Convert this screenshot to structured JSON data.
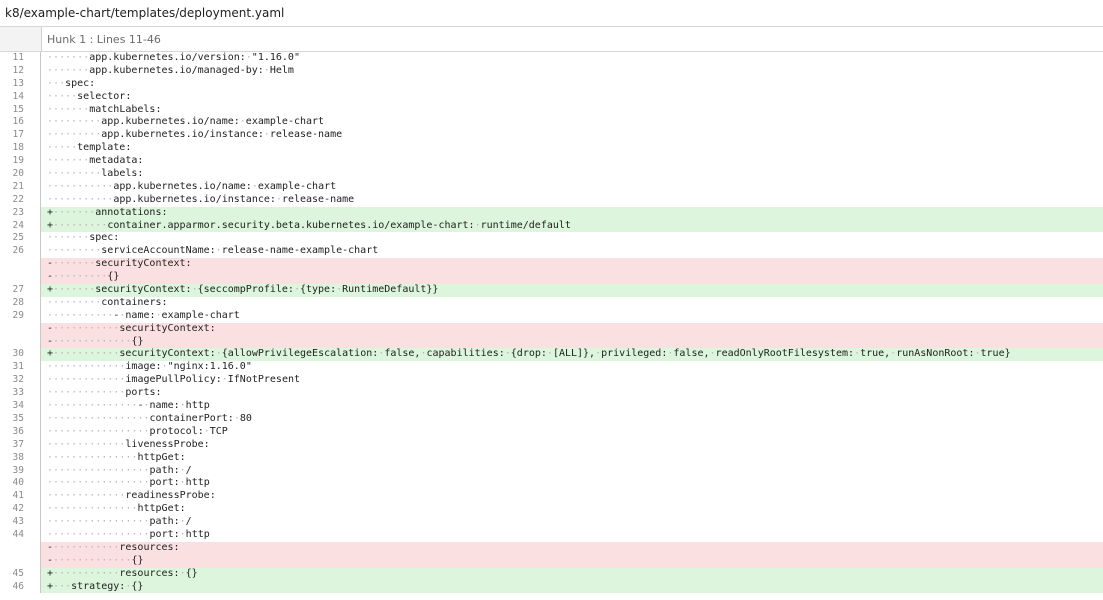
{
  "file": {
    "path": "k8/example-chart/templates/deployment.yaml"
  },
  "hunk": {
    "label": "Hunk 1 : Lines 11-46"
  },
  "lines": [
    {
      "num": "11",
      "type": "ctx",
      "sign": "",
      "text": "      app.kubernetes.io/version: \"1.16.0\""
    },
    {
      "num": "12",
      "type": "ctx",
      "sign": "",
      "text": "      app.kubernetes.io/managed-by: Helm"
    },
    {
      "num": "13",
      "type": "ctx",
      "sign": "",
      "text": "  spec:"
    },
    {
      "num": "14",
      "type": "ctx",
      "sign": "",
      "text": "    selector:"
    },
    {
      "num": "15",
      "type": "ctx",
      "sign": "",
      "text": "      matchLabels:"
    },
    {
      "num": "16",
      "type": "ctx",
      "sign": "",
      "text": "        app.kubernetes.io/name: example-chart"
    },
    {
      "num": "17",
      "type": "ctx",
      "sign": "",
      "text": "        app.kubernetes.io/instance: release-name"
    },
    {
      "num": "18",
      "type": "ctx",
      "sign": "",
      "text": "    template:"
    },
    {
      "num": "19",
      "type": "ctx",
      "sign": "",
      "text": "      metadata:"
    },
    {
      "num": "20",
      "type": "ctx",
      "sign": "",
      "text": "        labels:"
    },
    {
      "num": "21",
      "type": "ctx",
      "sign": "",
      "text": "          app.kubernetes.io/name: example-chart"
    },
    {
      "num": "22",
      "type": "ctx",
      "sign": "",
      "text": "          app.kubernetes.io/instance: release-name"
    },
    {
      "num": "23",
      "type": "add",
      "sign": "+",
      "text": "       annotations:"
    },
    {
      "num": "24",
      "type": "add",
      "sign": "+",
      "text": "         container.apparmor.security.beta.kubernetes.io/example-chart: runtime/default"
    },
    {
      "num": "25",
      "type": "ctx",
      "sign": "",
      "text": "      spec:"
    },
    {
      "num": "26",
      "type": "ctx",
      "sign": "",
      "text": "        serviceAccountName: release-name-example-chart"
    },
    {
      "num": "",
      "type": "del",
      "sign": "-",
      "text": "       securityContext:"
    },
    {
      "num": "",
      "type": "del",
      "sign": "-",
      "text": "         {}"
    },
    {
      "num": "27",
      "type": "add",
      "sign": "+",
      "text": "       securityContext: {seccompProfile: {type: RuntimeDefault}}"
    },
    {
      "num": "28",
      "type": "ctx",
      "sign": "",
      "text": "        containers:"
    },
    {
      "num": "29",
      "type": "ctx",
      "sign": "",
      "text": "          - name: example-chart"
    },
    {
      "num": "",
      "type": "del",
      "sign": "-",
      "text": "           securityContext:"
    },
    {
      "num": "",
      "type": "del",
      "sign": "-",
      "text": "             {}"
    },
    {
      "num": "30",
      "type": "add",
      "sign": "+",
      "text": "           securityContext: {allowPrivilegeEscalation: false, capabilities: {drop: [ALL]}, privileged: false, readOnlyRootFilesystem: true, runAsNonRoot: true}"
    },
    {
      "num": "31",
      "type": "ctx",
      "sign": "",
      "text": "            image: \"nginx:1.16.0\""
    },
    {
      "num": "32",
      "type": "ctx",
      "sign": "",
      "text": "            imagePullPolicy: IfNotPresent"
    },
    {
      "num": "33",
      "type": "ctx",
      "sign": "",
      "text": "            ports:"
    },
    {
      "num": "34",
      "type": "ctx",
      "sign": "",
      "text": "              - name: http"
    },
    {
      "num": "35",
      "type": "ctx",
      "sign": "",
      "text": "                containerPort: 80"
    },
    {
      "num": "36",
      "type": "ctx",
      "sign": "",
      "text": "                protocol: TCP"
    },
    {
      "num": "37",
      "type": "ctx",
      "sign": "",
      "text": "            livenessProbe:"
    },
    {
      "num": "38",
      "type": "ctx",
      "sign": "",
      "text": "              httpGet:"
    },
    {
      "num": "39",
      "type": "ctx",
      "sign": "",
      "text": "                path: /"
    },
    {
      "num": "40",
      "type": "ctx",
      "sign": "",
      "text": "                port: http"
    },
    {
      "num": "41",
      "type": "ctx",
      "sign": "",
      "text": "            readinessProbe:"
    },
    {
      "num": "42",
      "type": "ctx",
      "sign": "",
      "text": "              httpGet:"
    },
    {
      "num": "43",
      "type": "ctx",
      "sign": "",
      "text": "                path: /"
    },
    {
      "num": "44",
      "type": "ctx",
      "sign": "",
      "text": "                port: http"
    },
    {
      "num": "",
      "type": "del",
      "sign": "-",
      "text": "           resources:"
    },
    {
      "num": "",
      "type": "del",
      "sign": "-",
      "text": "             {}"
    },
    {
      "num": "45",
      "type": "add",
      "sign": "+",
      "text": "           resources: {}"
    },
    {
      "num": "46",
      "type": "add",
      "sign": "+",
      "text": "   strategy: {}"
    }
  ],
  "colors": {
    "added_bg": "#dcf5dc",
    "removed_bg": "#fbe0e2",
    "whitespace_dot": "#b5b5b5"
  }
}
